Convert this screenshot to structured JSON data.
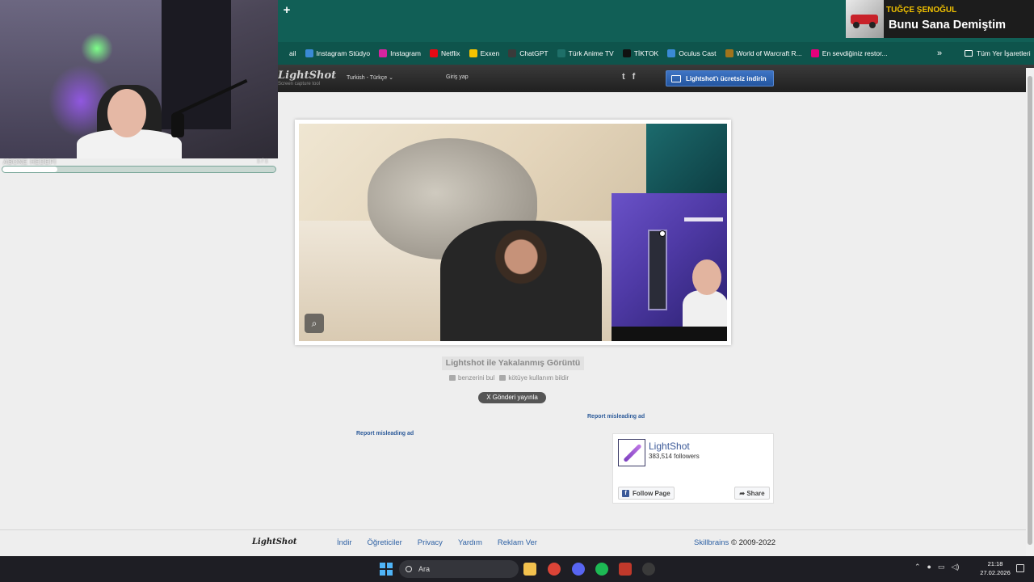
{
  "browser": {
    "new_tab_label": "+",
    "bookmarks": [
      {
        "label": "ail",
        "icon": "mail-icon",
        "color": "#0e544c"
      },
      {
        "label": "Instagram Stüdyo",
        "icon": "meta-icon",
        "color": "#3a8ad6"
      },
      {
        "label": "Instagram",
        "icon": "instagram-icon",
        "color": "#d6249f"
      },
      {
        "label": "Netflix",
        "icon": "netflix-icon",
        "color": "#e50914"
      },
      {
        "label": "Exxen",
        "icon": "exxen-icon",
        "color": "#f5c400"
      },
      {
        "label": "ChatGPT",
        "icon": "chatgpt-icon",
        "color": "#3a3a3a"
      },
      {
        "label": "Türk Anime TV",
        "icon": "anime-icon",
        "color": "#1e6f68"
      },
      {
        "label": "TİKTOK",
        "icon": "tiktok-icon",
        "color": "#111111"
      },
      {
        "label": "Oculus Cast",
        "icon": "oculus-icon",
        "color": "#3a8ad6"
      },
      {
        "label": "World of Warcraft R...",
        "icon": "warcraft-icon",
        "color": "#a0741c"
      },
      {
        "label": "En sevdiğiniz restor...",
        "icon": "yemeksepeti-icon",
        "color": "#e4007c"
      }
    ],
    "more_label": "»",
    "all_bookmarks_label": "Tüm Yer İşaretleri"
  },
  "lightshot_header": {
    "logo": "LightShot",
    "logo_sub": "Screen capture tool",
    "language": "Turkish - Türkçe ⌄",
    "login": "Giriş yap",
    "twitter": "t",
    "facebook": "f",
    "download_label": "Lightshot'ı ücretsiz indirin"
  },
  "screenshot": {
    "caption": "Lightshot ile Yakalanmış Görüntü",
    "search_similar": "benzerini bul",
    "report_abuse": "kötüye kullanım bildir",
    "tweet_label": "X  Gönderi yayınla",
    "search_icon_glyph": "⌕"
  },
  "ads": {
    "report_right": "Report misleading ad",
    "report_left": "Report misleading ad"
  },
  "facebook_widget": {
    "page_name": "LightShot",
    "followers": "383,514 followers",
    "follow_label": "Follow Page",
    "share_label": "Share"
  },
  "footer": {
    "logo": "LightShot",
    "links": [
      "İndir",
      "Öğreticiler",
      "Privacy",
      "Yardım",
      "Reklam Ver"
    ],
    "brand": "Skillbrains",
    "copyright": "© 2009-2022"
  },
  "stream": {
    "goal_label": "ABONE HEDEFİ",
    "goal_count": "1 / 1",
    "goal_progress": 0.2,
    "alert_name": "TUĞÇE ŞENOĞUL",
    "alert_message": "Bunu Sana Demiştim"
  },
  "taskbar": {
    "search_placeholder": "Ara",
    "time": "21:18",
    "date": "27.02.2026",
    "tray_icons": [
      "chevron-up-icon",
      "mic-icon",
      "monitor-icon",
      "speaker-icon"
    ],
    "apps": [
      {
        "name": "file-explorer-icon",
        "color": "#f2c14e"
      },
      {
        "name": "chrome-icon",
        "color": "#db4437"
      },
      {
        "name": "discord-icon",
        "color": "#5865f2"
      },
      {
        "name": "spotify-icon",
        "color": "#1db954"
      },
      {
        "name": "voicemod-icon",
        "color": "#c0392b"
      },
      {
        "name": "obs-icon",
        "color": "#3a3a3a"
      }
    ]
  }
}
